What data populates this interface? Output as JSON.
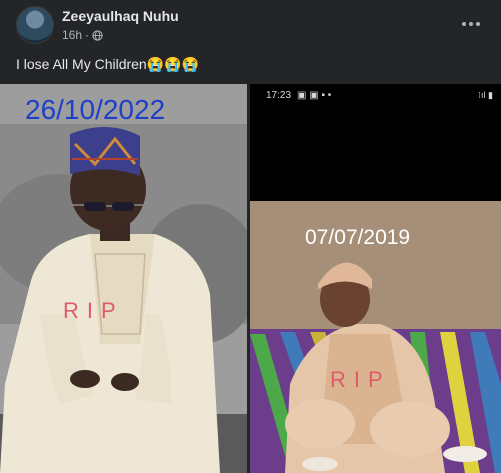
{
  "post": {
    "author": "Zeeyaulhaq Nuhu",
    "time": "16h",
    "dot": "·",
    "text": "I lose All My Children",
    "emojis": "😭😭😭",
    "privacy_icon": "globe-icon",
    "more_icon": "more-horizontal-icon"
  },
  "photos": [
    {
      "date": "26/10/2022",
      "overlay": "RIP"
    },
    {
      "date": "07/07/2019",
      "overlay": "RIP",
      "status_time": "17:23"
    }
  ],
  "colors": {
    "background": "#242526",
    "text": "#e4e6eb",
    "secondary": "#b0b3b8",
    "date_blue": "#1e40c8",
    "rip": "#e05a6a"
  }
}
